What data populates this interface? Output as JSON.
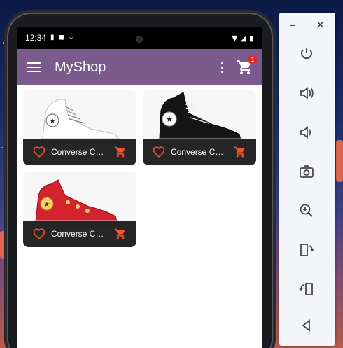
{
  "status_bar": {
    "time": "12:34"
  },
  "app_bar": {
    "title": "MyShop",
    "cart_count": "1"
  },
  "products": [
    {
      "title": "Converse Chuck Taylor",
      "variant": "white"
    },
    {
      "title": "Converse Chuck Taylor",
      "variant": "black"
    },
    {
      "title": "Converse Chuck Taylor",
      "variant": "red"
    }
  ],
  "emulator_panel": {
    "window_controls": [
      "minimize-icon",
      "close-icon"
    ],
    "tools": [
      "power-icon",
      "volume-up-icon",
      "volume-down-icon",
      "camera-icon",
      "zoom-icon",
      "rotate-left-icon",
      "rotate-right-icon",
      "back-icon"
    ]
  },
  "colors": {
    "app_bar": "#7b5a8d",
    "accent_icons": "#f0532d",
    "card_bar": "#141414",
    "badge": "#e12a2a"
  }
}
